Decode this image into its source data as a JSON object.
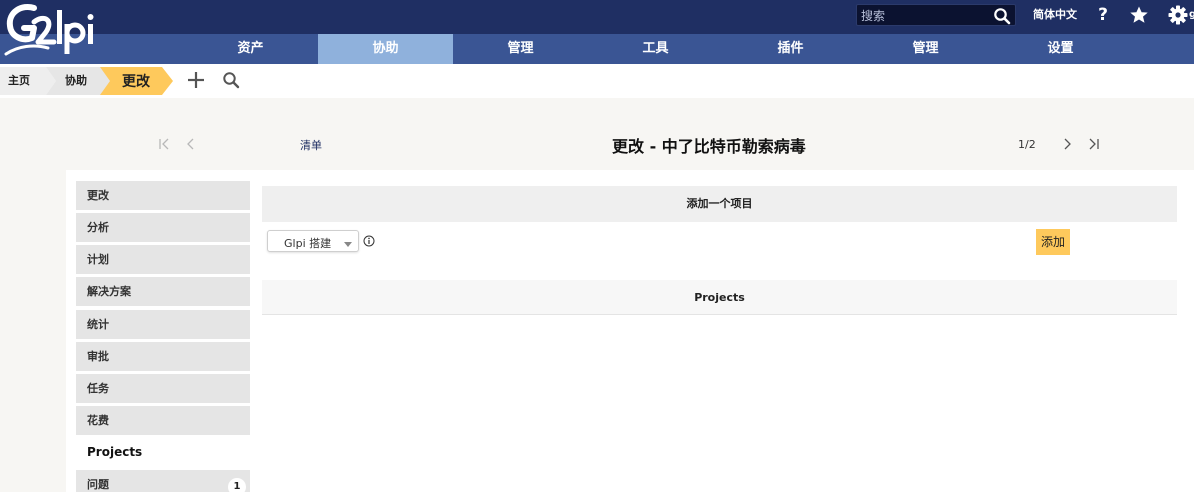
{
  "header": {
    "logo_alt": "Glpi",
    "search": {
      "placeholder": "搜索",
      "value": ""
    },
    "language": "简体中文",
    "help_label": "?",
    "user_initial": "g",
    "bar_color": "#1f2f63"
  },
  "nav": {
    "items": [
      {
        "label": "资产"
      },
      {
        "label": "协助",
        "active": true
      },
      {
        "label": "管理"
      },
      {
        "label": "工具"
      },
      {
        "label": "插件"
      },
      {
        "label": "管理"
      },
      {
        "label": "设置"
      }
    ],
    "bar_color": "#3a5594",
    "active_color": "#8fb1dc"
  },
  "breadcrumb": {
    "home": "主页",
    "section": "协助",
    "current": "更改",
    "current_color": "#fec95c"
  },
  "record_header": {
    "list_link": "清单",
    "title": "更改 - 中了比特币勒索病毒",
    "pager": "1/2"
  },
  "tabs": {
    "items": [
      {
        "label": "更改"
      },
      {
        "label": "分析"
      },
      {
        "label": "计划"
      },
      {
        "label": "解决方案"
      },
      {
        "label": "统计"
      },
      {
        "label": "审批"
      },
      {
        "label": "任务"
      },
      {
        "label": "花费"
      },
      {
        "label": "Projects",
        "active": true
      },
      {
        "label": "问题",
        "badge": "1"
      }
    ]
  },
  "content": {
    "add_section_title": "添加一个项目",
    "type_select_value": "Glpi 搭建",
    "add_button": "添加",
    "projects_title": "Projects"
  }
}
